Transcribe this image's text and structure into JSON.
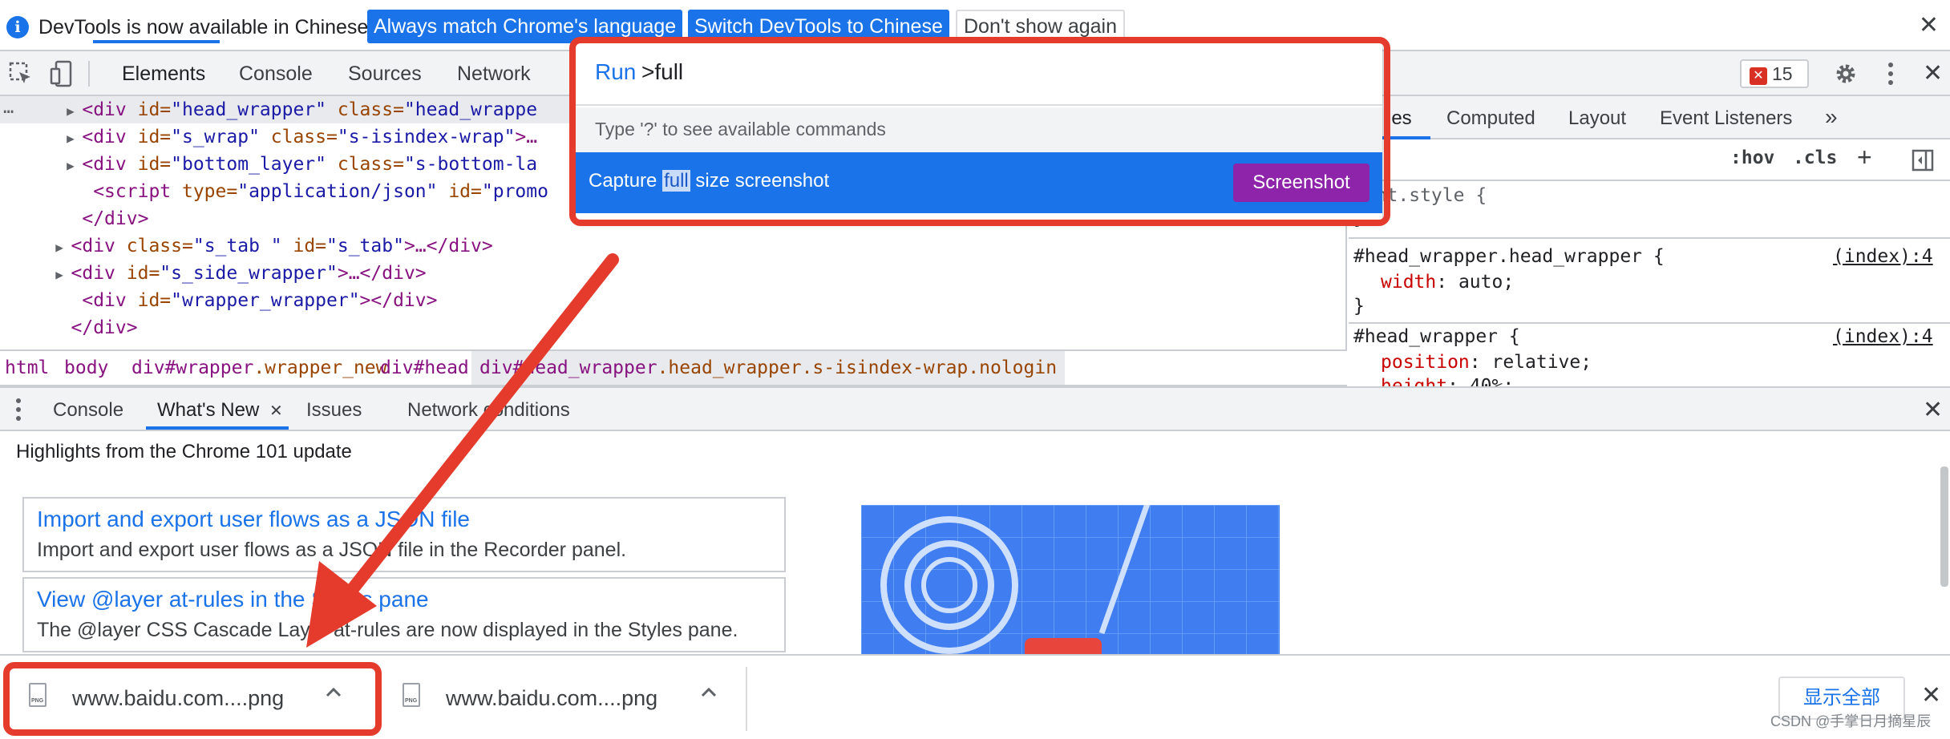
{
  "infobar": {
    "message": "DevTools is now available in Chinese!",
    "btn_match": "Always match Chrome's language",
    "btn_switch": "Switch DevTools to Chinese",
    "btn_dont_show": "Don't show again",
    "close": "✕"
  },
  "toolbar": {
    "tabs": [
      "Elements",
      "Console",
      "Sources",
      "Network"
    ],
    "error_count": "15",
    "close": "✕"
  },
  "elements": {
    "lines": [
      {
        "indent": "    ",
        "tri": "▶",
        "open": "<div",
        "a1": " id=",
        "v1": "\"head_wrapper\"",
        "a2": " class=",
        "v2": "\"head_wrappe"
      },
      {
        "indent": "    ",
        "tri": "▶",
        "open": "<div",
        "a1": " id=",
        "v1": "\"s_wrap\"",
        "a2": " class=",
        "v2": "\"s-isindex-wrap\"",
        "rest": ">…"
      },
      {
        "indent": "    ",
        "tri": "▶",
        "open": "<div",
        "a1": " id=",
        "v1": "\"bottom_layer\"",
        "a2": " class=",
        "v2": "\"s-bottom-la"
      },
      {
        "indent": "     ",
        "tri": "",
        "open": "<script",
        "a1": " type=",
        "v1": "\"application/json\"",
        "a2": " id=",
        "v2": "\"promo"
      },
      {
        "indent": "    ",
        "tri": "",
        "open": "</div>",
        "a1": "",
        "v1": "",
        "a2": "",
        "v2": ""
      },
      {
        "indent": "   ",
        "tri": "▶",
        "open": "<div",
        "a1": " class=",
        "v1": "\"s_tab \"",
        "a2": " id=",
        "v2": "\"s_tab\"",
        "rest": ">…</div>"
      },
      {
        "indent": "   ",
        "tri": "▶",
        "open": "<div",
        "a1": " id=",
        "v1": "\"s_side_wrapper\"",
        "a2": "",
        "v2": "",
        "rest": ">…</div>"
      },
      {
        "indent": "    ",
        "tri": "",
        "open": "<div",
        "a1": " id=",
        "v1": "\"wrapper_wrapper\"",
        "a2": "",
        "v2": "",
        "rest": "></div>"
      },
      {
        "indent": "   ",
        "tri": "",
        "open": "</div>",
        "a1": "",
        "v1": "",
        "a2": "",
        "v2": ""
      }
    ],
    "ellipsis": "…"
  },
  "breadcrumb": {
    "html": "html",
    "body": "body",
    "wrapper_tag": "div#wrapper",
    "wrapper_cls": ".wrapper_new",
    "head": "div#head",
    "head_wrapper_tag": "div#head_wrapper",
    "head_wrapper_cls": ".head_wrapper.s-isindex-wrap.nologin"
  },
  "styles": {
    "tabs": [
      "les",
      "Computed",
      "Layout",
      "Event Listeners"
    ],
    "more": "»",
    "filter_placeholder": "er",
    "hov": ":hov",
    "cls": ".cls",
    "plus": "+",
    "element_style": "ment.style {",
    "brace_close": "}",
    "rule1_selector": "#head_wrapper.head_wrapper {",
    "rule1_source": "(index):4",
    "rule1_prop": "width",
    "rule1_value": ": auto;",
    "rule2_selector": "#head_wrapper {",
    "rule2_source": "(index):4",
    "rule2_prop": "position",
    "rule2_value": ": relative;",
    "rule2_prop2": "height",
    "rule2_value2": ": 40%;"
  },
  "drawer": {
    "tabs": [
      "Console",
      "What's New",
      "Issues",
      "Network conditions"
    ],
    "tab_close": "✕",
    "close": "✕",
    "heading": "Highlights from the Chrome 101 update",
    "cards": [
      {
        "title": "Import and export user flows as a JSON file",
        "desc": "Import and export user flows as a JSON file in the Recorder panel."
      },
      {
        "title": "View @layer at-rules in the Styles pane",
        "desc": "The @layer CSS Cascade Layer at-rules are now displayed in the Styles pane."
      }
    ]
  },
  "command_menu": {
    "run_label": "Run",
    "input_value": ">full",
    "hint": "Type '?' to see available commands",
    "item_prefix": "Capture ",
    "item_highlight": "full",
    "item_suffix": " size screenshot",
    "item_button": "Screenshot"
  },
  "downloads": {
    "items": [
      {
        "name": "www.baidu.com....png"
      },
      {
        "name": "www.baidu.com....png"
      }
    ],
    "file_type": "PNG",
    "chevron": "^",
    "show_all": "显示全部",
    "close": "✕"
  },
  "watermark": "CSDN @手掌日月摘星辰",
  "colors": {
    "accent": "#1a73e8",
    "annotation_red": "#e53b2c",
    "screenshot_button": "#8e24aa"
  }
}
